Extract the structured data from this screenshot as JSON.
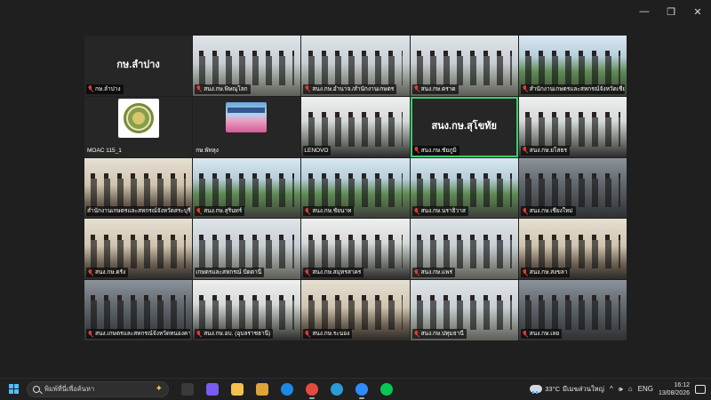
{
  "window": {
    "controls": {
      "minimize": "—",
      "restore": "❐",
      "close": "✕"
    }
  },
  "tiles": [
    {
      "label": "กษ.ลำปาง",
      "center": "กษ.ลำปาง",
      "kind": "black",
      "mic": true
    },
    {
      "label": "สนง.กษ.พิษณุโลก",
      "kind": "video",
      "mic": true
    },
    {
      "label": "สนง.กษ.อำนาจ./สำนักงานเกษตร",
      "kind": "video",
      "mic": true
    },
    {
      "label": "สนง.กษ.ตราด",
      "kind": "video",
      "mic": true
    },
    {
      "label": "สำนักงานเกษตรและสหกรณ์จังหวัดเชียงราย",
      "kind": "v-out",
      "mic": true
    },
    {
      "label": "MOAC 115_1",
      "kind": "logo-moac",
      "mic": false
    },
    {
      "label": "กษ.พัทลุง",
      "kind": "logo-pk",
      "mic": false
    },
    {
      "label": "LENOVO",
      "kind": "v-in2",
      "mic": false
    },
    {
      "label": "สนง.กษ.ชัยภูมิ",
      "center": "สนง.กษ.สุโขทัย",
      "kind": "black",
      "active": true,
      "mic": true
    },
    {
      "label": "สนง.กษ.ยโสธร",
      "kind": "v-in2",
      "mic": true
    },
    {
      "label": "สำนักงานเกษตรและสหกรณ์จังหวัดสระบุรี",
      "kind": "v-warm",
      "mic": false
    },
    {
      "label": "สนง.กษ.สุรินทร์",
      "kind": "v-out",
      "mic": true
    },
    {
      "label": "สนง.กษ.ชัยนาท",
      "kind": "v-out",
      "mic": true
    },
    {
      "label": "สนง.กษ.นราธิวาส",
      "kind": "v-out",
      "mic": true
    },
    {
      "label": "สนง.กษ.เชียงใหม่",
      "kind": "v-dark",
      "mic": true
    },
    {
      "label": "สนง.กษ.ตรัง",
      "kind": "v-warm",
      "mic": true
    },
    {
      "label": "เกษตรและสหกรณ์ ปัตตานี",
      "kind": "video",
      "mic": false
    },
    {
      "label": "สนง.กษ.สมุทรสาคร",
      "kind": "v-in2",
      "mic": true
    },
    {
      "label": "สนง.กษ.แพร่",
      "kind": "video",
      "mic": true
    },
    {
      "label": "สนง.กษ.สงขลา",
      "kind": "v-warm",
      "mic": true
    },
    {
      "label": "สนง.เกษตรและสหกรณ์จังหวัดหนองคาย",
      "kind": "v-dark",
      "mic": true
    },
    {
      "label": "สนง.กษ.อบ. (อุบลราชธานี)",
      "kind": "v-in2",
      "mic": true
    },
    {
      "label": "สนง.กษ.ระนอง",
      "kind": "v-warm",
      "mic": true
    },
    {
      "label": "สนง.กษ.ปทุมธานี",
      "kind": "video",
      "mic": true
    },
    {
      "label": "สนง.กษ.เลย",
      "kind": "v-dark",
      "mic": true
    }
  ],
  "taskbar": {
    "search_placeholder": "พิมพ์ที่นี่เพื่อค้นหา",
    "apps": [
      {
        "name": "task-view-icon",
        "color": "#3a3a3a",
        "running": false
      },
      {
        "name": "copilot-icon",
        "color": "#7a5cf0",
        "running": false
      },
      {
        "name": "file-explorer-icon",
        "color": "#f2c14e",
        "running": false
      },
      {
        "name": "pen-app-icon",
        "color": "#e0a23a",
        "running": false
      },
      {
        "name": "internet-explorer-icon",
        "color": "#1e88e5",
        "running": false
      },
      {
        "name": "chrome-icon",
        "color": "#e54b3c",
        "running": true
      },
      {
        "name": "edge-icon",
        "color": "#2c9bd6",
        "running": false
      },
      {
        "name": "zoom-icon",
        "color": "#2d8cff",
        "running": true
      },
      {
        "name": "line-icon",
        "color": "#06c755",
        "running": false
      }
    ],
    "weather": {
      "badge": "1",
      "temp": "33°C",
      "desc": "มีเมฆส่วนใหญ่"
    },
    "tray_icons": [
      "^",
      "🕪",
      "⌂",
      "ENG"
    ],
    "time": "16:12",
    "date": "13/08/2026"
  }
}
